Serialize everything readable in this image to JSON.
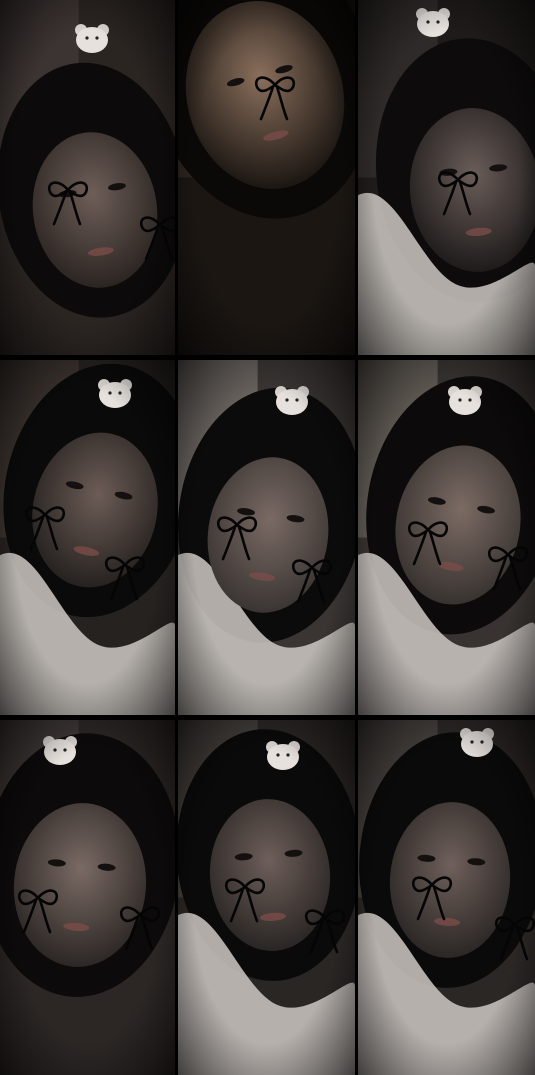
{
  "collage": {
    "rows": 3,
    "columns": 3,
    "tiles": [
      {
        "id": "r1c1",
        "bg": "#2b2522",
        "face_tone": "#6e5e58",
        "hair_tone": "#0c0a0a",
        "bow_count": 2,
        "has_clip": true,
        "has_blanket": false,
        "light": "#4a4240"
      },
      {
        "id": "r1c2",
        "bg": "#1b1612",
        "face_tone": "#8a6f5c",
        "hair_tone": "#0b0908",
        "bow_count": 1,
        "has_clip": false,
        "has_blanket": false,
        "light": "#3a2f27"
      },
      {
        "id": "r1c3",
        "bg": "#1e1b1a",
        "face_tone": "#6a5d59",
        "hair_tone": "#0d0b0b",
        "bow_count": 1,
        "has_clip": true,
        "has_blanket": true,
        "light": "#3c3736"
      },
      {
        "id": "r2c1",
        "bg": "#262220",
        "face_tone": "#6c5c56",
        "hair_tone": "#0b0a0a",
        "bow_count": 2,
        "has_clip": true,
        "has_blanket": true,
        "light": "#4a403b"
      },
      {
        "id": "r2c2",
        "bg": "#3a3533",
        "face_tone": "#7a6a64",
        "hair_tone": "#0c0b0b",
        "bow_count": 2,
        "has_clip": true,
        "has_blanket": true,
        "light": "#8d8580"
      },
      {
        "id": "r2c3",
        "bg": "#383330",
        "face_tone": "#7c6b64",
        "hair_tone": "#0c0a0a",
        "bow_count": 2,
        "has_clip": true,
        "has_blanket": true,
        "light": "#7d7670"
      },
      {
        "id": "r3c1",
        "bg": "#2c2725",
        "face_tone": "#7a6a64",
        "hair_tone": "#0c0a0a",
        "bow_count": 2,
        "has_clip": true,
        "has_blanket": false,
        "light": "#4d4643"
      },
      {
        "id": "r3c2",
        "bg": "#2a2624",
        "face_tone": "#6e5f5a",
        "hair_tone": "#0b0a0a",
        "bow_count": 2,
        "has_clip": true,
        "has_blanket": true,
        "light": "#55504c"
      },
      {
        "id": "r3c3",
        "bg": "#2b2725",
        "face_tone": "#6f605b",
        "hair_tone": "#0b0a0a",
        "bow_count": 2,
        "has_clip": true,
        "has_blanket": true,
        "light": "#5a5450"
      }
    ]
  }
}
